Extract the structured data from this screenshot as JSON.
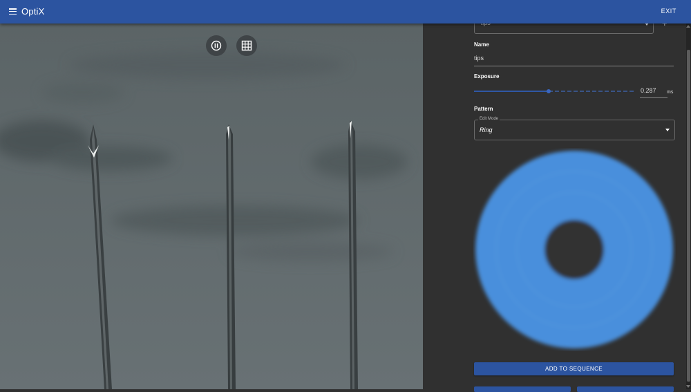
{
  "appbar": {
    "title": "OptiX",
    "exit_label": "EXIT",
    "color": "#2c54a0"
  },
  "viewer": {
    "pause_icon": "pause-circle-icon",
    "grid_icon": "grid-icon"
  },
  "panel": {
    "preset_value": "tips",
    "add_icon": "plus-icon",
    "name_label": "Name",
    "name_value": "tips",
    "exposure_label": "Exposure",
    "exposure_value": "0.287",
    "exposure_unit": "ms",
    "exposure_slider_fraction": 0.466,
    "pattern_label": "Pattern",
    "edit_mode_label": "Edit Mode",
    "edit_mode_value": "Ring",
    "pattern_color": "#4a8fdc",
    "add_to_sequence_label": "ADD TO SEQUENCE"
  }
}
